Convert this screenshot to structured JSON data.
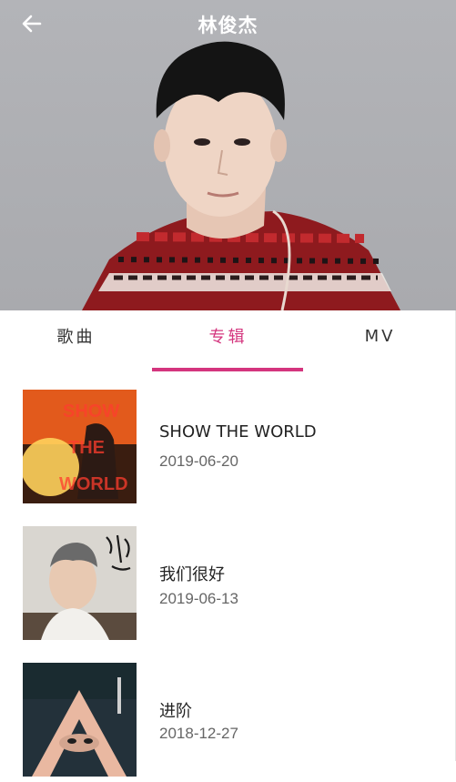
{
  "header": {
    "title": "林俊杰",
    "back_icon": "arrow-left-icon"
  },
  "tabs": [
    {
      "label": "歌曲",
      "active": false
    },
    {
      "label": "专辑",
      "active": true
    },
    {
      "label": "MV",
      "active": false
    }
  ],
  "accent_color": "#d4357e",
  "albums": [
    {
      "name": "SHOW THE WORLD",
      "date": "2019-06-20"
    },
    {
      "name": "我们很好",
      "date": "2019-06-13"
    },
    {
      "name": "进阶",
      "date": "2018-12-27"
    }
  ]
}
